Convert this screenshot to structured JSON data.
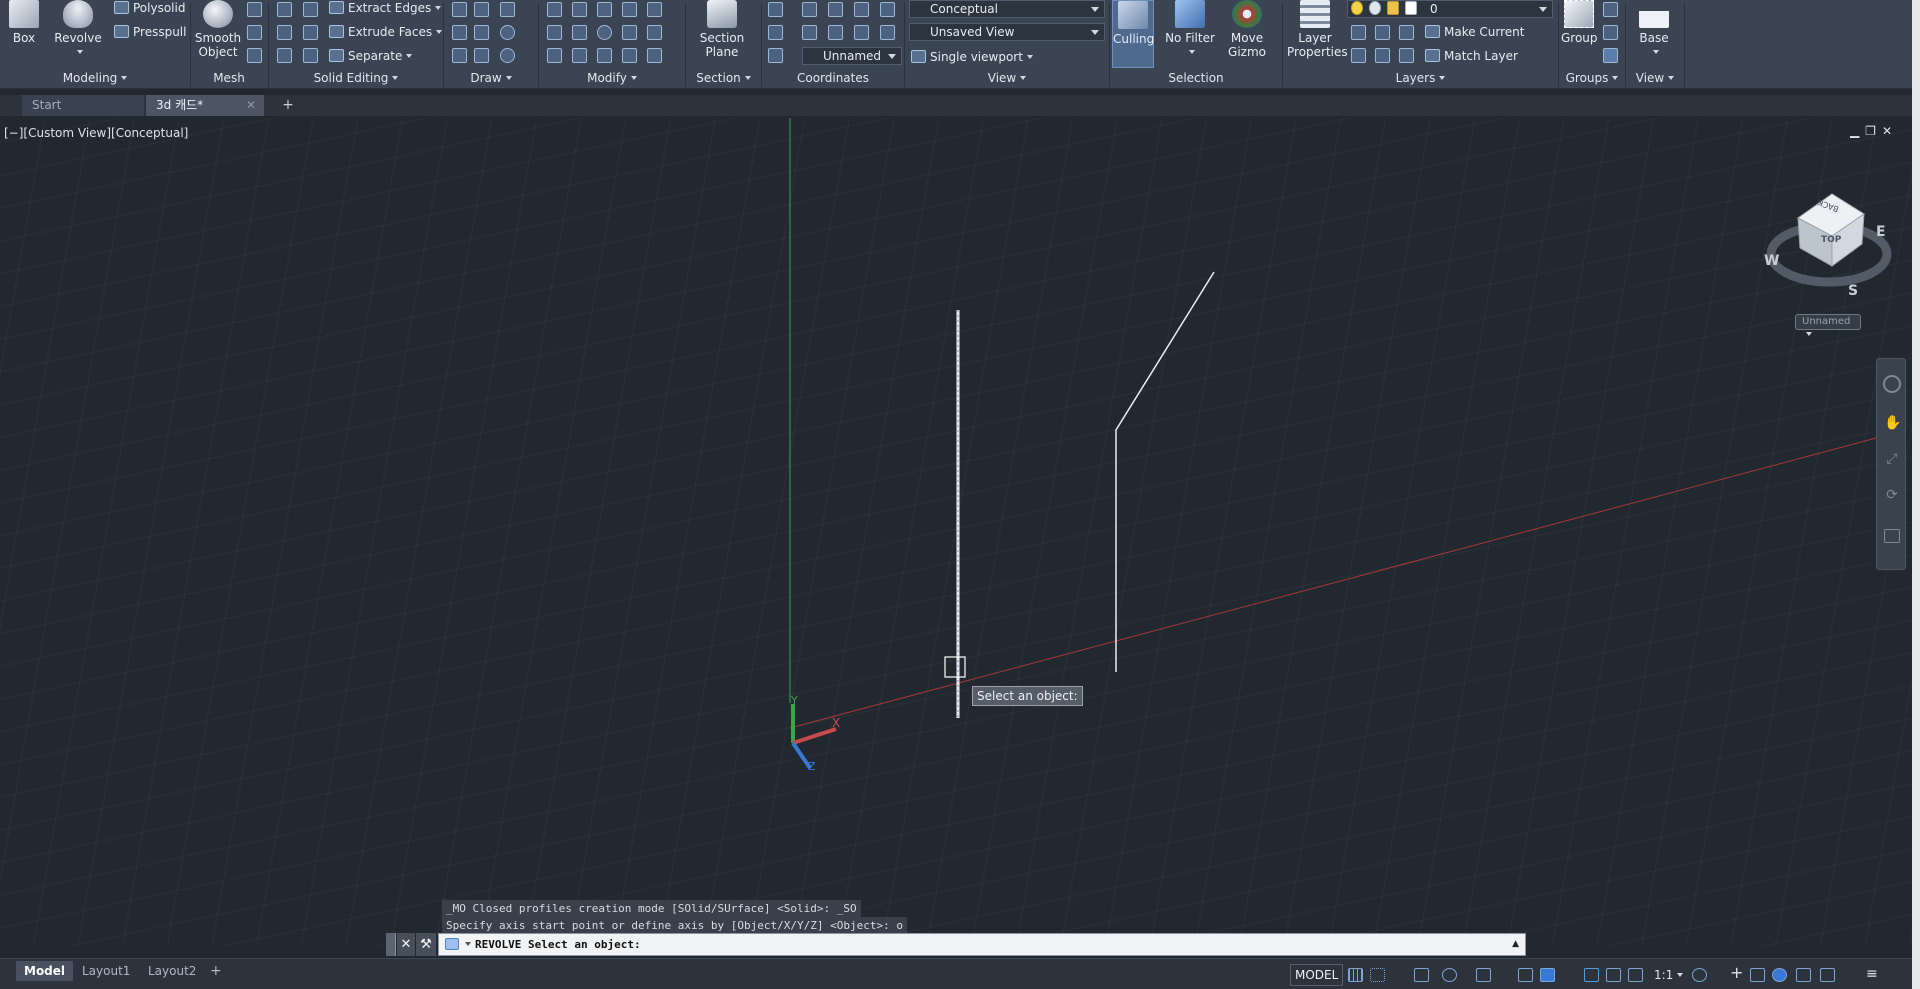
{
  "ribbon": {
    "modeling": {
      "title": "Modeling",
      "box": "Box",
      "revolve": "Revolve",
      "polysolid": "Polysolid",
      "presspull": "Presspull"
    },
    "mesh": {
      "title": "Mesh",
      "smooth_object": "Smooth Object"
    },
    "solid_editing": {
      "title": "Solid Editing",
      "extract_edges": "Extract Edges",
      "extrude_faces": "Extrude Faces",
      "separate": "Separate"
    },
    "draw": {
      "title": "Draw"
    },
    "modify": {
      "title": "Modify"
    },
    "section": {
      "title": "Section",
      "section_plane": "Section Plane"
    },
    "coordinates": {
      "title": "Coordinates",
      "ucs": "Unnamed"
    },
    "view": {
      "title": "View",
      "visual_style": "Conceptual",
      "named_view": "Unsaved View",
      "viewport": "Single viewport"
    },
    "selection": {
      "title": "Selection",
      "culling": "Culling",
      "no_filter": "No Filter",
      "move_gizmo": "Move Gizmo"
    },
    "layers": {
      "title": "Layers",
      "layer_properties": "Layer Properties",
      "layer_name": "0",
      "make_current": "Make Current",
      "match_layer": "Match Layer"
    },
    "groups": {
      "title": "Groups",
      "group": "Group"
    },
    "view2": {
      "title": "View",
      "base": "Base"
    }
  },
  "file_tabs": [
    {
      "label": "Start"
    },
    {
      "label": "3d 캐드*"
    }
  ],
  "viewport": {
    "label": "[−][Custom View][Conceptual]",
    "tooltip": "Select an object:",
    "viewcube": {
      "top": "TOP",
      "back": "BACK",
      "north": "",
      "west": "W",
      "east": "E",
      "south": "S",
      "ucs": "Unnamed"
    },
    "axes": {
      "x": "X",
      "y": "Y",
      "z": "Z"
    },
    "colors": {
      "x_axis": "#c03a3a",
      "y_axis": "#3aa64a",
      "z_axis": "#3a78d6",
      "geometry": "#e9eef4"
    }
  },
  "command": {
    "history": [
      "_MO Closed profiles creation mode [SOlid/SUrface] <Solid>: _SO",
      "Specify axis start point or define axis by [Object/X/Y/Z] <Object>: o"
    ],
    "prompt": "REVOLVE Select an object:"
  },
  "layout_tabs": [
    {
      "label": "Model"
    },
    {
      "label": "Layout1"
    },
    {
      "label": "Layout2"
    }
  ],
  "status": {
    "model": "MODEL",
    "scale": "1:1"
  }
}
